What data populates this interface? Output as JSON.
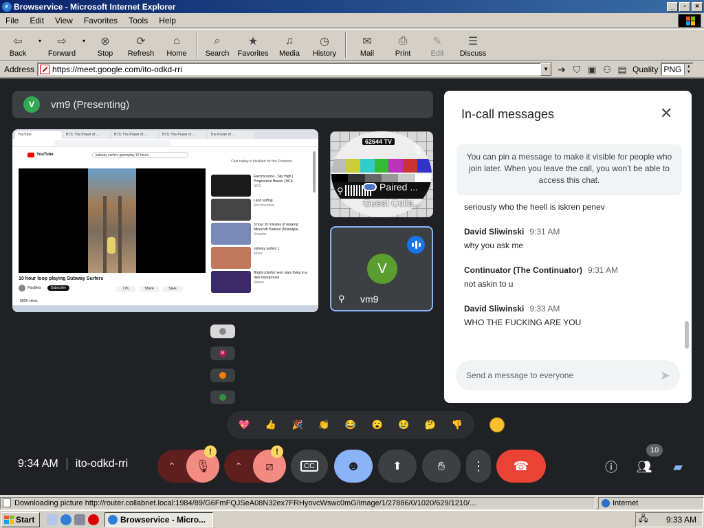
{
  "window": {
    "title": "Browservice - Microsoft Internet Explorer"
  },
  "menu": [
    "File",
    "Edit",
    "View",
    "Favorites",
    "Tools",
    "Help"
  ],
  "toolbar": {
    "back": "Back",
    "forward": "Forward",
    "stop": "Stop",
    "refresh": "Refresh",
    "home": "Home",
    "search": "Search",
    "favorites": "Favorites",
    "media": "Media",
    "history": "History",
    "mail": "Mail",
    "print": "Print",
    "edit": "Edit",
    "discuss": "Discuss"
  },
  "address": {
    "label": "Address",
    "url": "https://meet.google.com/ito-odkd-rri",
    "quality_label": "Quality",
    "quality_value": "PNG"
  },
  "meet": {
    "presenter_initial": "V",
    "presenter_label": "vm9 (Presenting)",
    "screen": {
      "tabs": [
        "YouTube",
        "BTS: The Power of ...",
        "BTS: The Power of ...",
        "BTS: The Power of ...",
        "The Power of ..."
      ],
      "search_text": "subway surfers gameplay 10 hours",
      "video_title": "10 hour loop playing Subway Surfers",
      "channel": "PlayBets",
      "subscribe": "Subscribe",
      "likes": "17K",
      "share": "Share",
      "save": "Save",
      "views": "500K views",
      "chat_disabled": "Chat replay is disabled for this Premiere.",
      "side": [
        {
          "title": "Electroconcie - Sky High | Progressive House | NCS",
          "meta": "NCS",
          "color": "#1a1a1a"
        },
        {
          "title": "Land surfing",
          "meta": "Recomended",
          "color": "#444"
        },
        {
          "title": "3 hour 10 minutes of relaxing Minecraft Parkour (Nostalgia)",
          "meta": "Snoader",
          "color": "#7a8ab8"
        },
        {
          "title": "subway surfers 1",
          "meta": "Mixes",
          "color": "#c0785a"
        },
        {
          "title": "Bright colorful neon stars flying in a dark background",
          "meta": "Nature",
          "color": "#3a2a6a"
        }
      ]
    },
    "tiles": {
      "tv_label": "62644 TV",
      "paired": "Paired ...",
      "guest": "Guest Colla...",
      "vm9_initial": "V",
      "vm9_name": "vm9"
    },
    "mini_tiles": [
      "",
      "M",
      "",
      ""
    ],
    "reactions": [
      "💖",
      "👍",
      "🎉",
      "👏",
      "😂",
      "😮",
      "😢",
      "🤔",
      "👎"
    ],
    "time": "9:34 AM",
    "meeting_code": "ito-odkd-rri",
    "people_count": "10"
  },
  "chat": {
    "title": "In-call messages",
    "pin_note": "You can pin a message to make it visible for people who join later. When you leave the call, you won't be able to access this chat.",
    "first_message": "seriously who the heell is iskren penev",
    "messages": [
      {
        "author": "David Sliwinski",
        "time": "9:31 AM",
        "text": "why you ask me"
      },
      {
        "author": "Continuator (The Continuator)",
        "time": "9:31 AM",
        "text": "not askin to u"
      },
      {
        "author": "David Sliwinski",
        "time": "9:33 AM",
        "text": "WHO THE FUCKING ARE YOU"
      }
    ],
    "input_placeholder": "Send a message to everyone"
  },
  "status": {
    "text": "Downloading picture http://router.collabnet.local:1984/89/G6FmFQJSeA08N32ex7FRHyovcWswc0mG/image/1/27886/0/1020/629/1210/...",
    "zone": "Internet"
  },
  "taskbar": {
    "start": "Start",
    "task": "Browservice - Micro...",
    "clock": "9:33 AM"
  }
}
